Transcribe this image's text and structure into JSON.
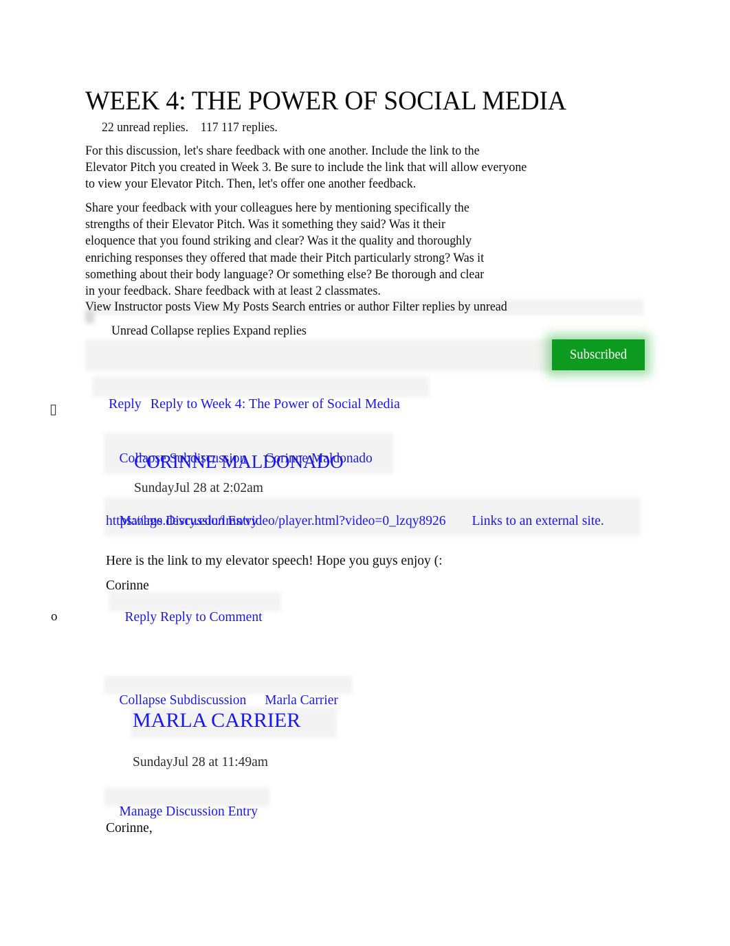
{
  "document": {
    "title": "WEEK 4: THE POWER OF SOCIAL MEDIA",
    "reply_counts": "22 unread replies.    117 117 replies.",
    "intro_paragraph_1": "For this discussion, let's share feedback with one another. Include the link to the\nElevator Pitch you created in Week 3. Be sure to include the link that will allow everyone\nto view your Elevator Pitch. Then, let's offer one another feedback.",
    "intro_paragraph_2": "Share your feedback with your colleagues here by mentioning specifically the\nstrengths of their Elevator Pitch. Was it something they said? Was it their\neloquence that you found striking and clear? Was it the quality and thoroughly\nenriching responses they offered that made their Pitch particularly strong? Was it\nsomething about their body language? Or something else? Be thorough and clear\nin your feedback. Share feedback with at least 2 classmates."
  },
  "toolbar": {
    "line_1": "View Instructor posts View My Posts Search entries or author Filter replies by unread",
    "line_2": "Unread Collapse replies Expand replies",
    "subscribed_label": "Subscribed",
    "subscribed_color": "#0d9b1f"
  },
  "thread_actions": {
    "reply_label": "Reply",
    "reply_to_topic_label": "Reply to Week 4: The Power of Social Media",
    "missing_glyph": "▯",
    "list_marker": "o"
  },
  "colors": {
    "link": "#1a18e8",
    "text": "#0d0d0d",
    "timestamp": "#2b2b2b",
    "page_background": "#ffffff"
  },
  "posts": [
    {
      "collapse_label": "Collapse Subdiscussion",
      "author_link": "Corinne Maldonado",
      "author_heading": "CORINNE MALDONADO",
      "timestamp": "SundayJul 28 at 2:02am",
      "manage_label": "Manage Discussion Entry",
      "url": "https://lms.devry.edu/lms/video/player.html?video=0_lzqy8926",
      "external_note": "Links to an external site.",
      "body": "Here is the link to my elevator speech! Hope you guys enjoy (:",
      "signature": "Corinne",
      "reply_label": "Reply",
      "reply_to_comment_label": "Reply to Comment"
    },
    {
      "collapse_label": "Collapse Subdiscussion",
      "author_link": "Marla Carrier",
      "author_heading": "MARLA CARRIER",
      "timestamp": "SundayJul 28 at 11:49am",
      "manage_label": "Manage Discussion Entry",
      "body": "Corinne,"
    }
  ]
}
